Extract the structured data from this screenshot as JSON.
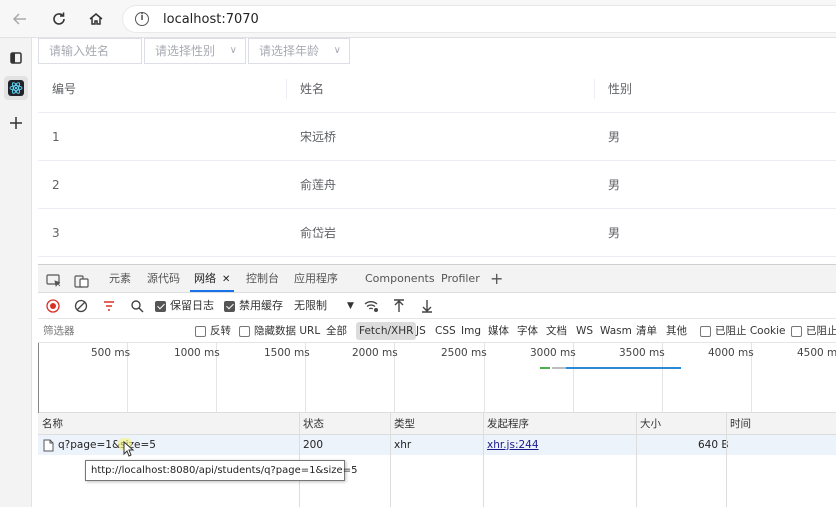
{
  "browser": {
    "url": "localhost:7070"
  },
  "filters": {
    "name_placeholder": "请输入姓名",
    "gender_placeholder": "请选择性别",
    "age_placeholder": "请选择年龄"
  },
  "table": {
    "headers": [
      "编号",
      "姓名",
      "性别"
    ],
    "rows": [
      {
        "id": "1",
        "name": "宋远桥",
        "gender": "男"
      },
      {
        "id": "2",
        "name": "俞莲舟",
        "gender": "男"
      },
      {
        "id": "3",
        "name": "俞岱岩",
        "gender": "男"
      }
    ]
  },
  "devtools": {
    "tabs": [
      "元素",
      "源代码",
      "网络",
      "控制台",
      "应用程序",
      "Components",
      "Profiler"
    ],
    "active_tab": "网络",
    "toolbar": {
      "preserve_log": "保留日志",
      "disable_cache": "禁用缓存",
      "throttle": "无限制"
    },
    "filter": {
      "label": "筛选器",
      "invert": "反转",
      "hide_data_url": "隐藏数据 URL",
      "types": [
        "全部",
        "Fetch/XHR",
        "JS",
        "CSS",
        "Img",
        "媒体",
        "字体",
        "文档",
        "WS",
        "Wasm",
        "清单",
        "其他"
      ],
      "active_type": "Fetch/XHR",
      "blocked_cookies": "已阻止 Cookie",
      "blocked_requests": "已阻止"
    },
    "timeline": {
      "labels": [
        "500 ms",
        "1000 ms",
        "1500 ms",
        "2000 ms",
        "2500 ms",
        "3000 ms",
        "3500 ms",
        "4000 ms",
        "4500 ms"
      ]
    },
    "requests": {
      "columns": [
        "名称",
        "状态",
        "类型",
        "发起程序",
        "大小",
        "时间"
      ],
      "rows": [
        {
          "name": "q?page=1&size=5",
          "status": "200",
          "type": "xhr",
          "initiator": "xhr.js:244",
          "size": "640 B",
          "time": ""
        }
      ]
    },
    "tooltip": "http://localhost:8080/api/students/q?page=1&size=5"
  },
  "colors": {
    "accent": "#1a73e8",
    "record": "#d93025",
    "timing_bar": "#2b8ad6"
  }
}
